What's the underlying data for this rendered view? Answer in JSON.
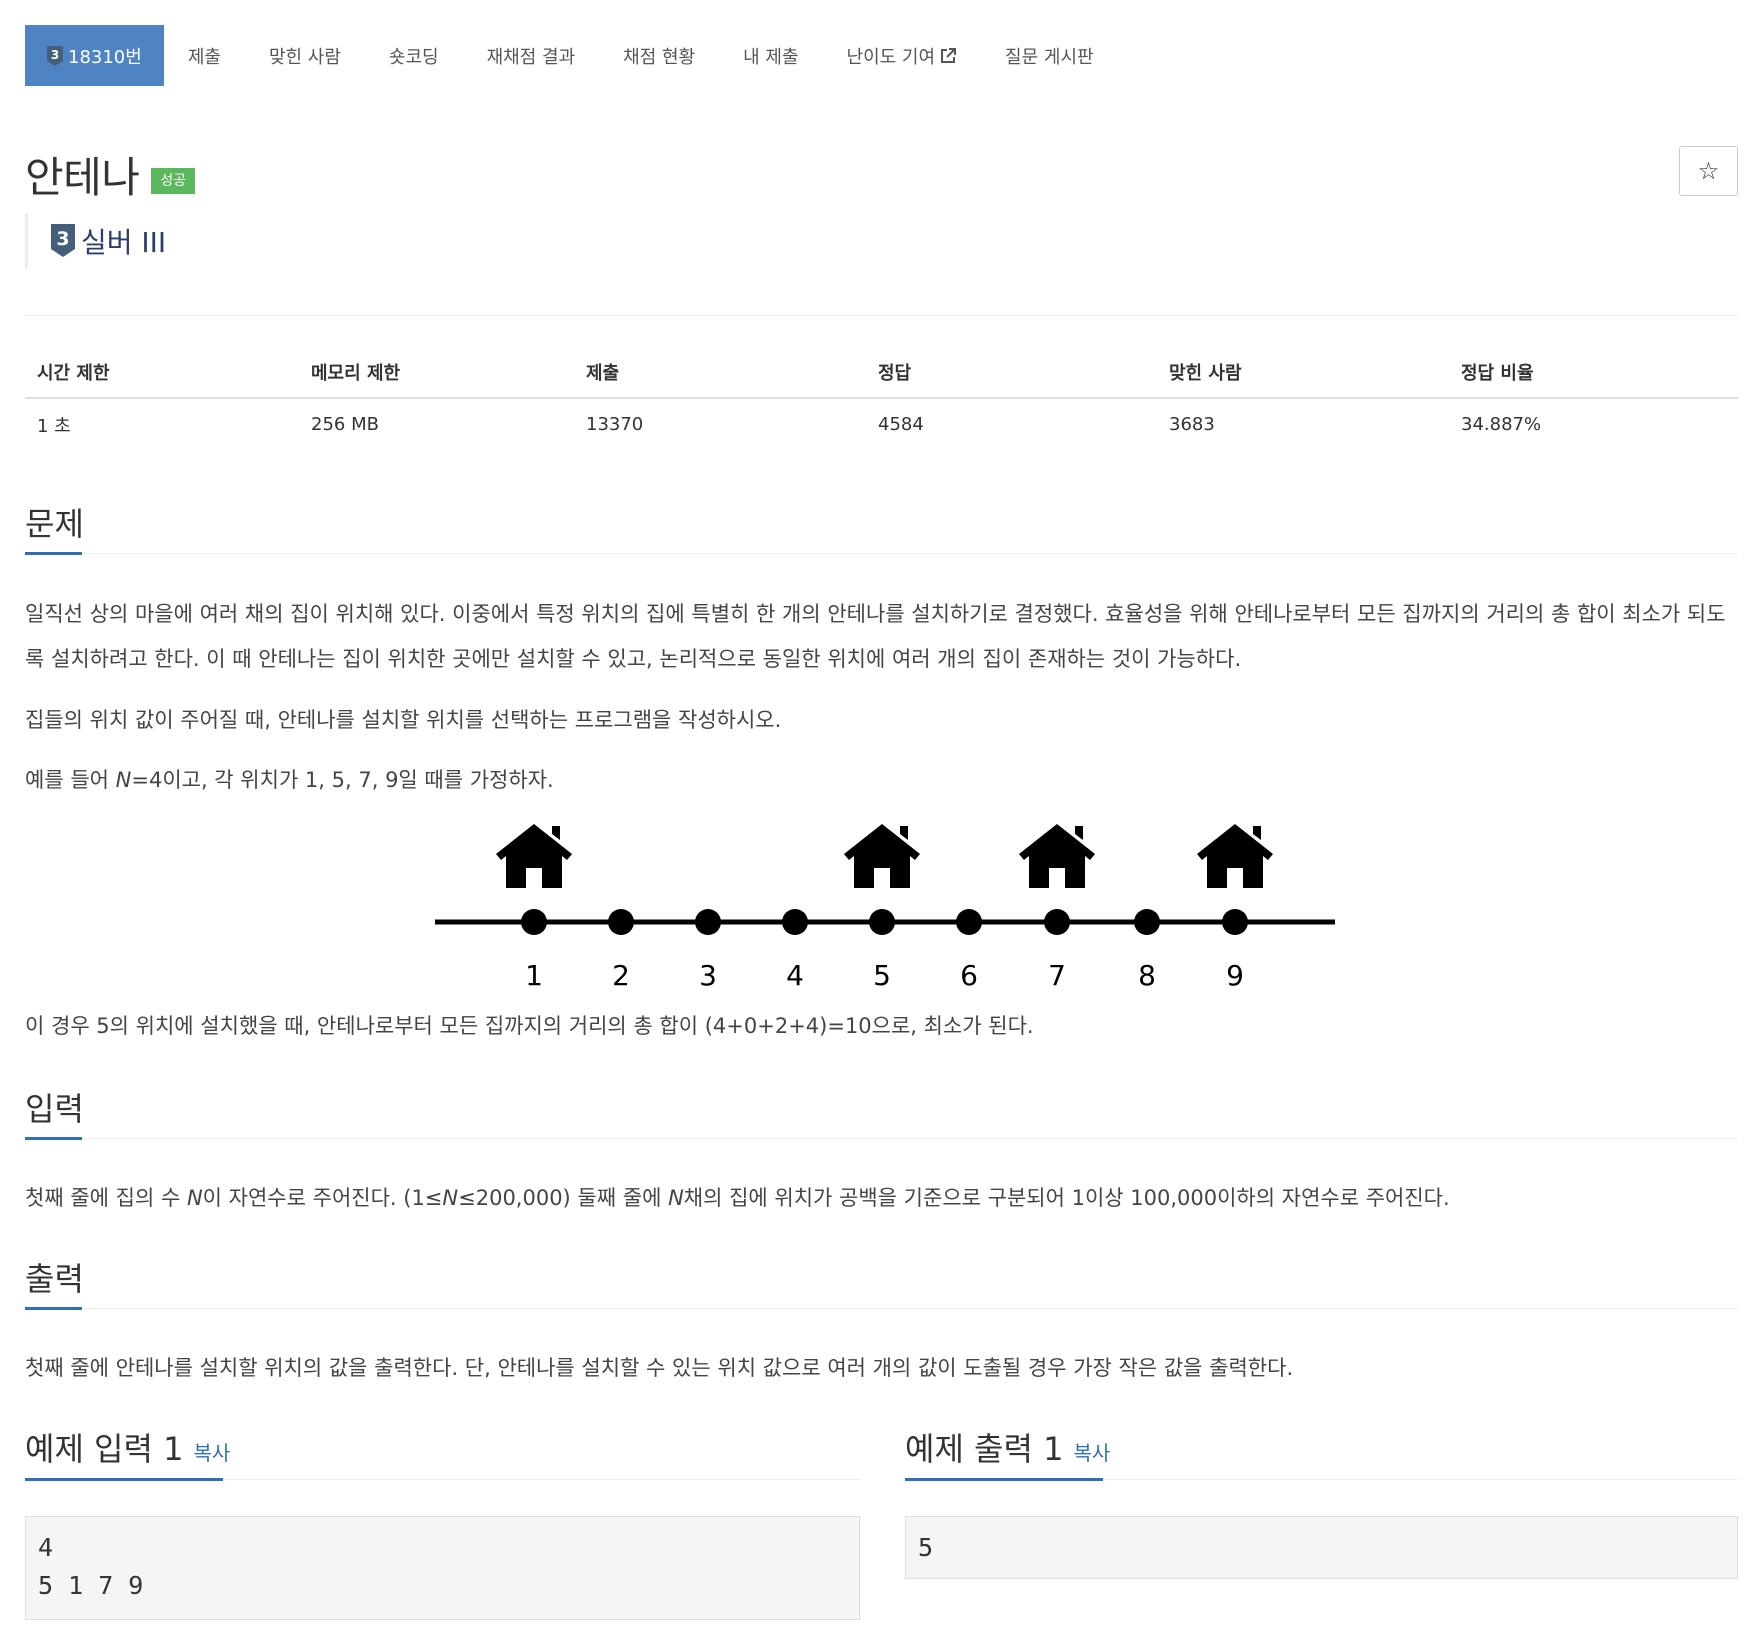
{
  "nav": {
    "items": [
      {
        "label": "18310번",
        "active": true,
        "tier_number": "3"
      },
      {
        "label": "제출"
      },
      {
        "label": "맞힌 사람"
      },
      {
        "label": "숏코딩"
      },
      {
        "label": "재채점 결과"
      },
      {
        "label": "채점 현황"
      },
      {
        "label": "내 제출"
      },
      {
        "label": "난이도 기여",
        "icon": "external-link-icon"
      },
      {
        "label": "질문 게시판"
      }
    ]
  },
  "problem": {
    "title": "안테나",
    "status_badge": "성공",
    "tier_number": "3",
    "tier_label": "실버 III",
    "star": "☆"
  },
  "info_table": {
    "headers": [
      "시간 제한",
      "메모리 제한",
      "제출",
      "정답",
      "맞힌 사람",
      "정답 비율"
    ],
    "values": [
      "1 초",
      "256 MB",
      "13370",
      "4584",
      "3683",
      "34.887%"
    ]
  },
  "sections": {
    "problem_head": "문제",
    "problem_p1": "일직선 상의 마을에 여러 채의 집이 위치해 있다. 이중에서 특정 위치의 집에 특별히 한 개의 안테나를 설치하기로 결정했다. 효율성을 위해 안테나로부터 모든 집까지의 거리의 총 합이 최소가 되도록 설치하려고 한다. 이 때 안테나는 집이 위치한 곳에만 설치할 수 있고, 논리적으로 동일한 위치에 여러 개의 집이 존재하는 것이 가능하다.",
    "problem_p2": "집들의 위치 값이 주어질 때, 안테나를 설치할 위치를 선택하는 프로그램을 작성하시오.",
    "problem_p3_a": "예를 들어 ",
    "problem_p3_n": "N",
    "problem_p3_b": "=4이고, 각 위치가 1, 5, 7, 9일 때를 가정하자.",
    "problem_p4": "이 경우 5의 위치에 설치했을 때, 안테나로부터 모든 집까지의 거리의 총 합이 (4+0+2+4)=10으로, 최소가 된다.",
    "input_head": "입력",
    "input_a": "첫째 줄에 집의 수 ",
    "input_n1": "N",
    "input_b": "이 자연수로 주어진다. (1≤",
    "input_n2": "N",
    "input_c": "≤200,000) 둘째 줄에 ",
    "input_n3": "N",
    "input_d": "채의 집에 위치가 공백을 기준으로 구분되어 1이상 100,000이하의 자연수로 주어진다.",
    "output_head": "출력",
    "output_p": "첫째 줄에 안테나를 설치할 위치의 값을 출력한다. 단, 안테나를 설치할 수 있는 위치 값으로 여러 개의 값이 도출될 경우 가장 작은 값을 출력한다."
  },
  "figure": {
    "positions": [
      "1",
      "2",
      "3",
      "4",
      "5",
      "6",
      "7",
      "8",
      "9"
    ],
    "house_positions": [
      1,
      5,
      7,
      9
    ],
    "icon": "house-icon"
  },
  "samples": {
    "input_title": "예제 입력 1",
    "output_title": "예제 출력 1",
    "copy_label": "복사",
    "input_text": "4\n5 1 7 9",
    "output_text": "5"
  },
  "colors": {
    "accent": "#4f84c4",
    "success": "#5cb85c",
    "link": "#2f6fb8"
  }
}
